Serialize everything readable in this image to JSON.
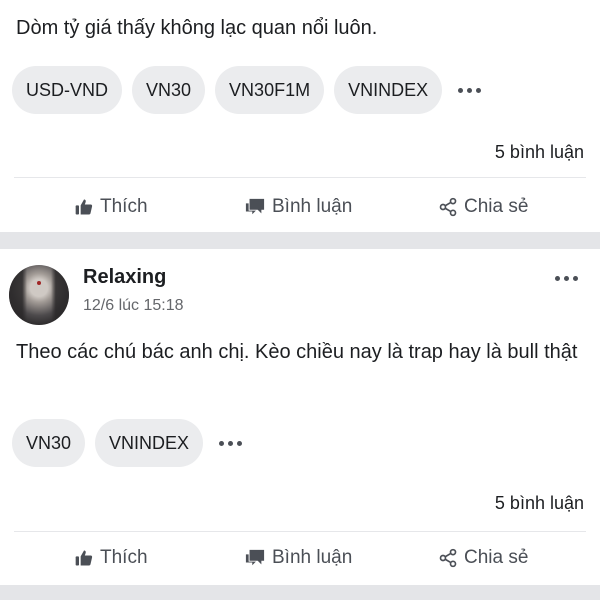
{
  "posts": [
    {
      "text": "Dòm tỷ giá thấy không lạc quan nổi luôn.",
      "tags": [
        "USD-VND",
        "VN30",
        "VN30F1M",
        "VNINDEX"
      ],
      "more_tags_icon": "more-horizontal-icon",
      "comment_count": "5 bình luận",
      "actions": {
        "like": "Thích",
        "comment": "Bình luận",
        "share": "Chia sẻ"
      }
    },
    {
      "author": "Relaxing",
      "time": "12/6 lúc 15:18",
      "text": "Theo các chú bác anh chị. Kèo chiều nay là trap hay là bull thật",
      "tags": [
        "VN30",
        "VNINDEX"
      ],
      "more_tags_icon": "more-horizontal-icon",
      "comment_count": "5 bình luận",
      "actions": {
        "like": "Thích",
        "comment": "Bình luận",
        "share": "Chia sẻ"
      }
    }
  ],
  "colors": {
    "separator": "#e4e5e8",
    "tag_bg": "#ebecee",
    "text": "#1c1e21",
    "muted": "#4b4f56",
    "time": "#65676b"
  }
}
